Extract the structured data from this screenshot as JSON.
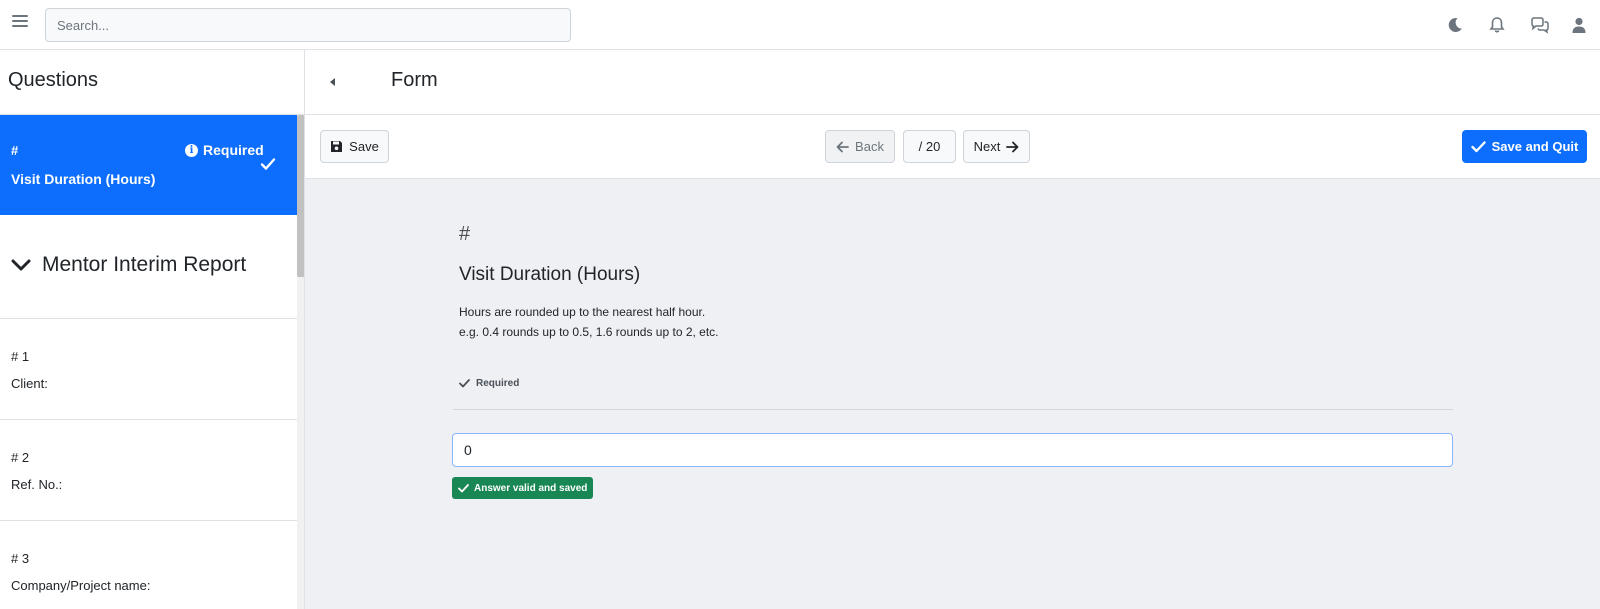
{
  "topbar": {
    "search_placeholder": "Search...",
    "icons": [
      "moon-icon",
      "bell-icon",
      "chat-icon",
      "user-icon"
    ]
  },
  "sidebar": {
    "title": "Questions",
    "active": {
      "hash": "#",
      "required": "Required",
      "label": "Visit Duration (Hours)"
    },
    "section": {
      "title": "Mentor Interim Report"
    },
    "items": [
      {
        "num": "# 1",
        "label": "Client:"
      },
      {
        "num": "# 2",
        "label": "Ref. No.:"
      },
      {
        "num": "# 3",
        "label": "Company/Project name:"
      }
    ]
  },
  "main": {
    "title": "Form",
    "toolbar": {
      "save_label": "Save",
      "back_label": "Back",
      "page_indicator": "/ 20",
      "next_label": "Next",
      "quit_label": "Save and Quit"
    },
    "question": {
      "hash": "#",
      "title": "Visit Duration (Hours)",
      "desc_line1": "Hours are rounded up to the nearest half hour.",
      "desc_line2": "e.g. 0.4 rounds up to 0.5, 1.6 rounds up to 2, etc.",
      "required": "Required",
      "answer": "0",
      "status": "Answer valid and saved"
    }
  },
  "colors": {
    "primary": "#0d6efd",
    "success": "#198754",
    "content_bg": "#eff0f4"
  }
}
